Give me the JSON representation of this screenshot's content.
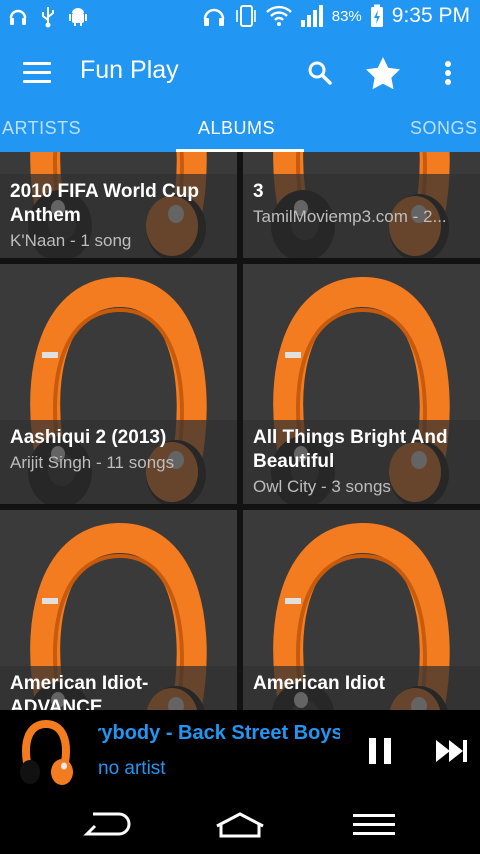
{
  "status_bar": {
    "battery_percent": "83%",
    "time": "9:35 PM",
    "left_icons": [
      "headset-notification-icon",
      "usb-icon",
      "android-debug-icon"
    ],
    "right_icons": [
      "headphones-icon",
      "vibrate-icon",
      "wifi-icon",
      "signal-icon",
      "battery-charging-icon"
    ]
  },
  "app_bar": {
    "title": "Fun Play",
    "actions": [
      "search-icon",
      "star-icon",
      "more-vert-icon"
    ]
  },
  "tabs": [
    {
      "label": "ARTISTS",
      "selected": false
    },
    {
      "label": "ALBUMS",
      "selected": true
    },
    {
      "label": "SONGS",
      "selected": false
    }
  ],
  "albums": [
    {
      "title": "2010 FIFA World Cup Anthem",
      "subtitle": "K'Naan - 1 song"
    },
    {
      "title": "3",
      "subtitle": "TamilMoviemp3.com - 2..."
    },
    {
      "title": "Aashiqui 2 (2013)",
      "subtitle": "Arijit Singh - 11 songs"
    },
    {
      "title": "All Things Bright And Beautiful",
      "subtitle": "Owl City - 3 songs"
    },
    {
      "title": "American Idiot-ADVANCE",
      "subtitle": ""
    },
    {
      "title": "American Idiot",
      "subtitle": ""
    }
  ],
  "now_playing": {
    "title": "Everybody - Back Street Boys",
    "artist": "no artist"
  },
  "colors": {
    "primary": "#2196f3",
    "accent_orange": "#f47c20",
    "background": "#121212"
  }
}
